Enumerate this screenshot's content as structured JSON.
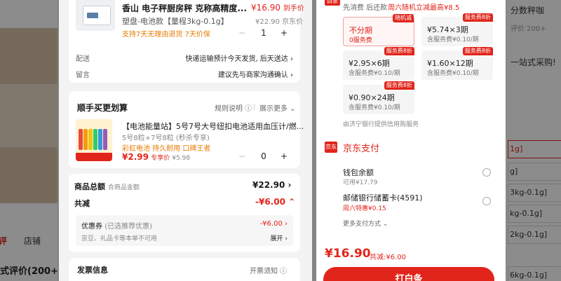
{
  "colors": {
    "brand_red": "#e1251b",
    "promo_orange": "#e77c00",
    "panel_bg": "#f3f3f3"
  },
  "background": {
    "tabs": [
      "评",
      "店铺"
    ],
    "eval_title": "式评价(200+)",
    "right_texts": [
      "分数秤咖",
      "评价 200+",
      "一站式采购!"
    ],
    "right_options": [
      "1g]",
      "g]",
      "3kg-0.1g]",
      "kg-0.1g]",
      "2kg-0.1g]",
      "6kg-0.1g]"
    ]
  },
  "product": {
    "title": "香山 电子秤厨房秤 克称高精度...",
    "price": "¥16.90",
    "price_suffix": "到手价",
    "spec": "塑盘-电池款【量程3kg-0.1g】",
    "original_price": "¥22.90 京东价",
    "promo": "支持7天无理由退货   7天价保",
    "quantity": "1",
    "minus_icon": "minus-icon",
    "plus_icon": "plus-icon"
  },
  "delivery": {
    "label": "配送",
    "value": "快递运输预计今天发货, 后天送达 ›"
  },
  "message": {
    "label": "留言",
    "value": "建议先与商家沟通确认 ›"
  },
  "addon": {
    "title": "顺手买更划算",
    "rules_link": "规则说明 ⓘ",
    "more_link": "展示更多 ⌄",
    "item_title": "【电池能量站】5号7号大号纽扣电池适用血压计/燃...",
    "item_spec": "5号8粒+7号8粒 (秒杀专享)",
    "item_tags": "彩虹电池 持久耐用 口碑王者",
    "item_price": "¥2.99",
    "item_price_note": "专享价",
    "item_orig": "¥5.98",
    "item_quantity": "0"
  },
  "summary": {
    "total_label": "商品总额",
    "total_sub": "合商品金额",
    "total_value": "¥22.90 ›",
    "discount_label": "共减",
    "discount_value": "-¥6.00 ⌃",
    "coupon_label": "优惠券",
    "coupon_note": "(已选推荐优惠)",
    "coupon_value": "-¥6.00 ›",
    "gift_card": "京豆、礼品卡等本单不可用",
    "expand": "展开 ›",
    "invoice_label": "发票信息",
    "invoice_link": "开票须知 ⓘ"
  },
  "installment": {
    "tag": "白条",
    "head_note": "先消费 后还款",
    "head_promo": "周六随机立减最高¥8.5",
    "options": [
      {
        "badge": "随机减",
        "main": "不分期",
        "sub": "0服务费",
        "selected": true
      },
      {
        "badge": "服务费8折",
        "main": "¥5.74×3期",
        "sub": "含服务费¥0.10/期",
        "selected": false
      },
      {
        "badge": "服务费8折",
        "main": "¥2.95×6期",
        "sub": "含服务费¥0.10/期",
        "selected": false
      },
      {
        "badge": "服务费8折",
        "main": "¥1.60×12期",
        "sub": "含服务费¥0.10/期",
        "selected": false
      },
      {
        "badge": "服务费8折",
        "main": "¥0.90×24期",
        "sub": "含服务费¥0.10/期",
        "selected": false
      }
    ],
    "bank_note": "由济宁银行提供信用购服务"
  },
  "jd_pay": {
    "icon_text": "京东",
    "title": "京东支付",
    "methods": [
      {
        "name": "钱包余额",
        "sub": "可用¥17.79"
      },
      {
        "name": "邮储银行储蓄卡(4591)",
        "sub": "周六特惠¥0.15"
      }
    ],
    "more": "更多支付方式 ⌄"
  },
  "footer": {
    "price": "¥16.90",
    "discount": "共减:¥6.00",
    "button": "打白条"
  }
}
